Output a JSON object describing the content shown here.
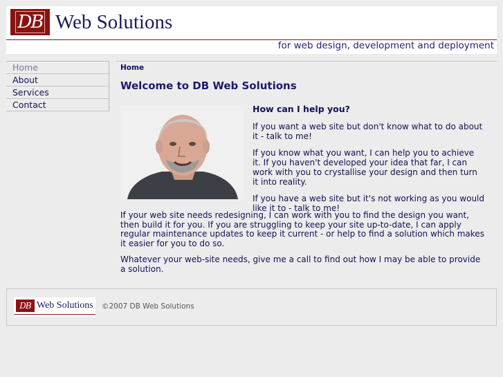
{
  "header": {
    "logo_text": "DB",
    "site_title": "Web Solutions",
    "tagline": "for web design, development and deployment",
    "brand_color": "#8c1212"
  },
  "nav": {
    "items": [
      {
        "label": "Home",
        "active": true
      },
      {
        "label": "About",
        "active": false
      },
      {
        "label": "Services",
        "active": false
      },
      {
        "label": "Contact",
        "active": false
      }
    ]
  },
  "main": {
    "breadcrumb": "Home",
    "title": "Welcome to DB Web Solutions",
    "help_heading": "How can I help you?",
    "side_paragraphs": [
      "If you want a web site but don't know what to do about it - talk to me!",
      "If you know what you want, I can help you to achieve it. If you haven't developed your idea that far, I can work with you to crystallise your design and then turn it into reality.",
      "If you have a web site but it's not working as you would like it to - talk to me!"
    ],
    "full_paragraphs": [
      "If your web site needs redesigning, I can work with you to find the design you want, then build it for you. If you are struggling to keep your site up-to-date, I can apply regular maintenance updates to keep it current - or help to find a solution which makes it easier for you to do so.",
      "Whatever your web-site needs, give me a call to find out how I may be able to provide a solution."
    ]
  },
  "footer": {
    "logo_text": "DB",
    "logo_title": "Web Solutions",
    "copyright": "©2007 DB Web Solutions"
  }
}
